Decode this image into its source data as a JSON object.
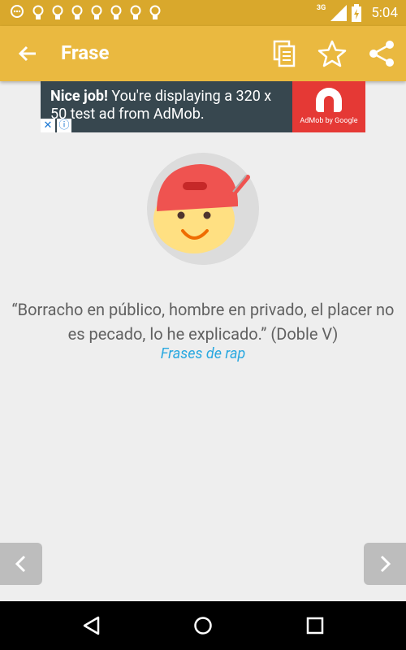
{
  "status_bar": {
    "network": "3G",
    "time": "5:04",
    "notification_icons": [
      "chat-icon",
      "bulb-icon",
      "bulb-icon",
      "bulb-icon",
      "bulb-icon",
      "bulb-icon",
      "bulb-icon",
      "bulb-icon"
    ]
  },
  "app_bar": {
    "title": "Frase",
    "actions": [
      "copy",
      "favorite",
      "share"
    ]
  },
  "ad": {
    "headline": "Nice job!",
    "body": "You're displaying a 320 x 50 test ad from AdMob.",
    "logo_text": "AdMob by Google",
    "close_label": "✕",
    "info_label": "ⓘ"
  },
  "quote": {
    "text": "“Borracho en público, hombre en privado, el placer no es pecado, lo he explicado.” (Doble V)",
    "category": "Frases de rap"
  },
  "navigation": {
    "prev_icon": "chevron-left-icon",
    "next_icon": "chevron-right-icon"
  },
  "colors": {
    "app_bar": "#eab940",
    "status_bar": "#d9a82c",
    "background": "#eeeeee",
    "category_link": "#29a8e0",
    "ad_bg": "#37474f",
    "ad_logo": "#e53935",
    "cap": "#ef5350",
    "face": "#ffe082"
  }
}
